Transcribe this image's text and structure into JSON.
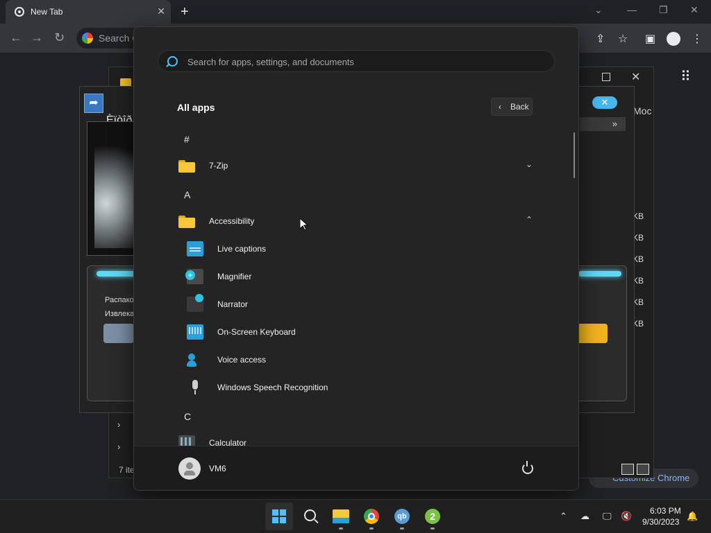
{
  "browser": {
    "tab_title": "New Tab",
    "omnibox_placeholder": "Search G",
    "customize_label": "Customize Chrome"
  },
  "background_windows": {
    "extract_title": "Èïòîð",
    "extract_line1": "Распако",
    "extract_line2": "Извлека",
    "status": "7 ite",
    "mod_label": "Moc",
    "size_unit": "KB"
  },
  "start_menu": {
    "search_placeholder": "Search for apps, settings, and documents",
    "all_apps_title": "All apps",
    "back_label": "Back",
    "groups": [
      {
        "letter": "#"
      },
      {
        "letter": "A"
      },
      {
        "letter": "C"
      }
    ],
    "folders": [
      {
        "label": "7-Zip",
        "expanded": false
      },
      {
        "label": "Accessibility",
        "expanded": true
      }
    ],
    "accessibility_apps": [
      {
        "label": "Live captions",
        "icon": "live-captions-icon"
      },
      {
        "label": "Magnifier",
        "icon": "magnifier-icon"
      },
      {
        "label": "Narrator",
        "icon": "narrator-icon"
      },
      {
        "label": "On-Screen Keyboard",
        "icon": "keyboard-icon"
      },
      {
        "label": "Voice access",
        "icon": "voice-access-icon"
      },
      {
        "label": "Windows Speech Recognition",
        "icon": "microphone-icon"
      }
    ],
    "c_apps": [
      {
        "label": "Calculator",
        "icon": "calculator-icon"
      }
    ],
    "user": {
      "name": "VM6"
    }
  },
  "taskbar": {
    "time": "6:03 PM",
    "date": "9/30/2023",
    "qb_label": "qb",
    "two_label": "2"
  },
  "colors": {
    "accent": "#4cc2ff",
    "folder": "#f8c83a",
    "menu_bg": "#242424"
  }
}
